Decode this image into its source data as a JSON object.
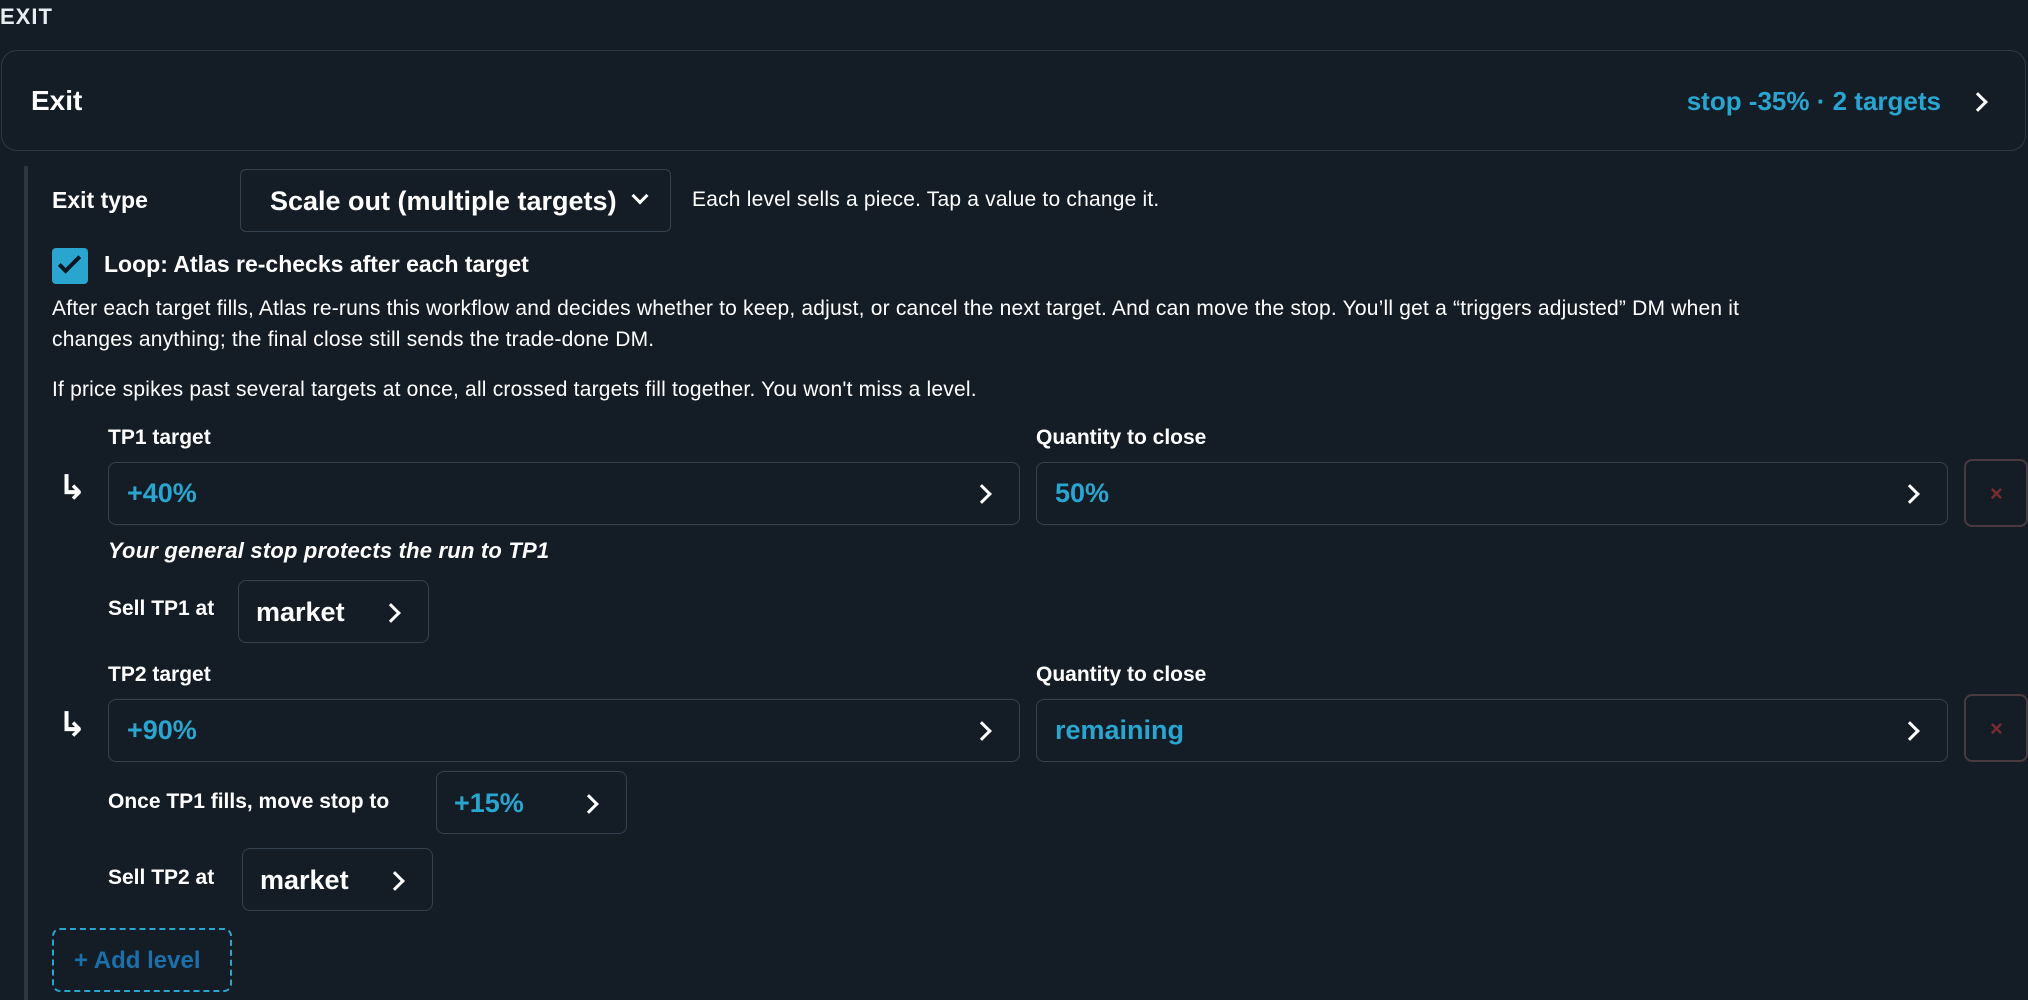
{
  "section_label": "EXIT",
  "exit_card": {
    "title": "Exit",
    "summary": "stop -35% · 2 targets"
  },
  "exit_type": {
    "label": "Exit type",
    "value": "Scale out (multiple targets)",
    "hint": "Each level sells a piece. Tap a value to change it."
  },
  "loop": {
    "checked": true,
    "label": "Loop: Atlas re-checks after each target",
    "description_line1": "After each target fills, Atlas re-runs this workflow and decides whether to keep, adjust, or cancel the next target. And can move the stop. You’ll get a “triggers adjusted” DM when it",
    "description_line2": "changes anything; the final close still sends the trade-done DM."
  },
  "spike_note": "If price spikes past several targets at once, all crossed targets fill together. You won't miss a level.",
  "levels": [
    {
      "target_label": "TP1 target",
      "target_value": "+40%",
      "quantity_label": "Quantity to close",
      "quantity_value": "50%",
      "note": "Your general stop protects the run to TP1",
      "sell_label": "Sell TP1 at",
      "sell_value": "market",
      "delete_icon": "×"
    },
    {
      "target_label": "TP2 target",
      "target_value": "+90%",
      "quantity_label": "Quantity to close",
      "quantity_value": "remaining",
      "move_stop_label": "Once TP1 fills, move stop to",
      "move_stop_value": "+15%",
      "sell_label": "Sell TP2 at",
      "sell_value": "market",
      "delete_icon": "×"
    }
  ],
  "level_icon": "↳",
  "add_level": "+ Add level",
  "colors": {
    "background": "#141d26",
    "accent": "#2aa5d0",
    "border": "#33414f"
  }
}
